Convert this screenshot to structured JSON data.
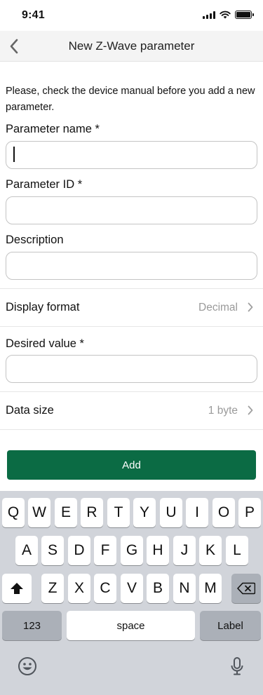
{
  "status_bar": {
    "time": "9:41"
  },
  "nav": {
    "title": "New Z-Wave parameter"
  },
  "form": {
    "intro": "Please, check the device manual before you add a new parameter.",
    "parameter_name": {
      "label": "Parameter name *",
      "value": ""
    },
    "parameter_id": {
      "label": "Parameter ID *",
      "value": ""
    },
    "description": {
      "label": "Description",
      "value": ""
    },
    "display_format": {
      "label": "Display format",
      "value": "Decimal"
    },
    "desired_value": {
      "label": "Desired value *",
      "value": ""
    },
    "data_size": {
      "label": "Data size",
      "value": "1 byte"
    },
    "add_label": "Add"
  },
  "colors": {
    "accent": "#0b6b44",
    "nav_bg": "#f4f4f4",
    "keyboard_bg": "#d1d4da"
  },
  "keyboard": {
    "row1": [
      "Q",
      "W",
      "E",
      "R",
      "T",
      "Y",
      "U",
      "I",
      "O",
      "P"
    ],
    "row2": [
      "A",
      "S",
      "D",
      "F",
      "G",
      "H",
      "J",
      "K",
      "L"
    ],
    "row3": [
      "Z",
      "X",
      "C",
      "V",
      "B",
      "N",
      "M"
    ],
    "numbers_label": "123",
    "space_label": "space",
    "return_label": "Label",
    "shift_icon": "shift-icon",
    "delete_icon": "backspace-icon",
    "emoji_icon": "emoji-icon",
    "mic_icon": "microphone-icon"
  }
}
